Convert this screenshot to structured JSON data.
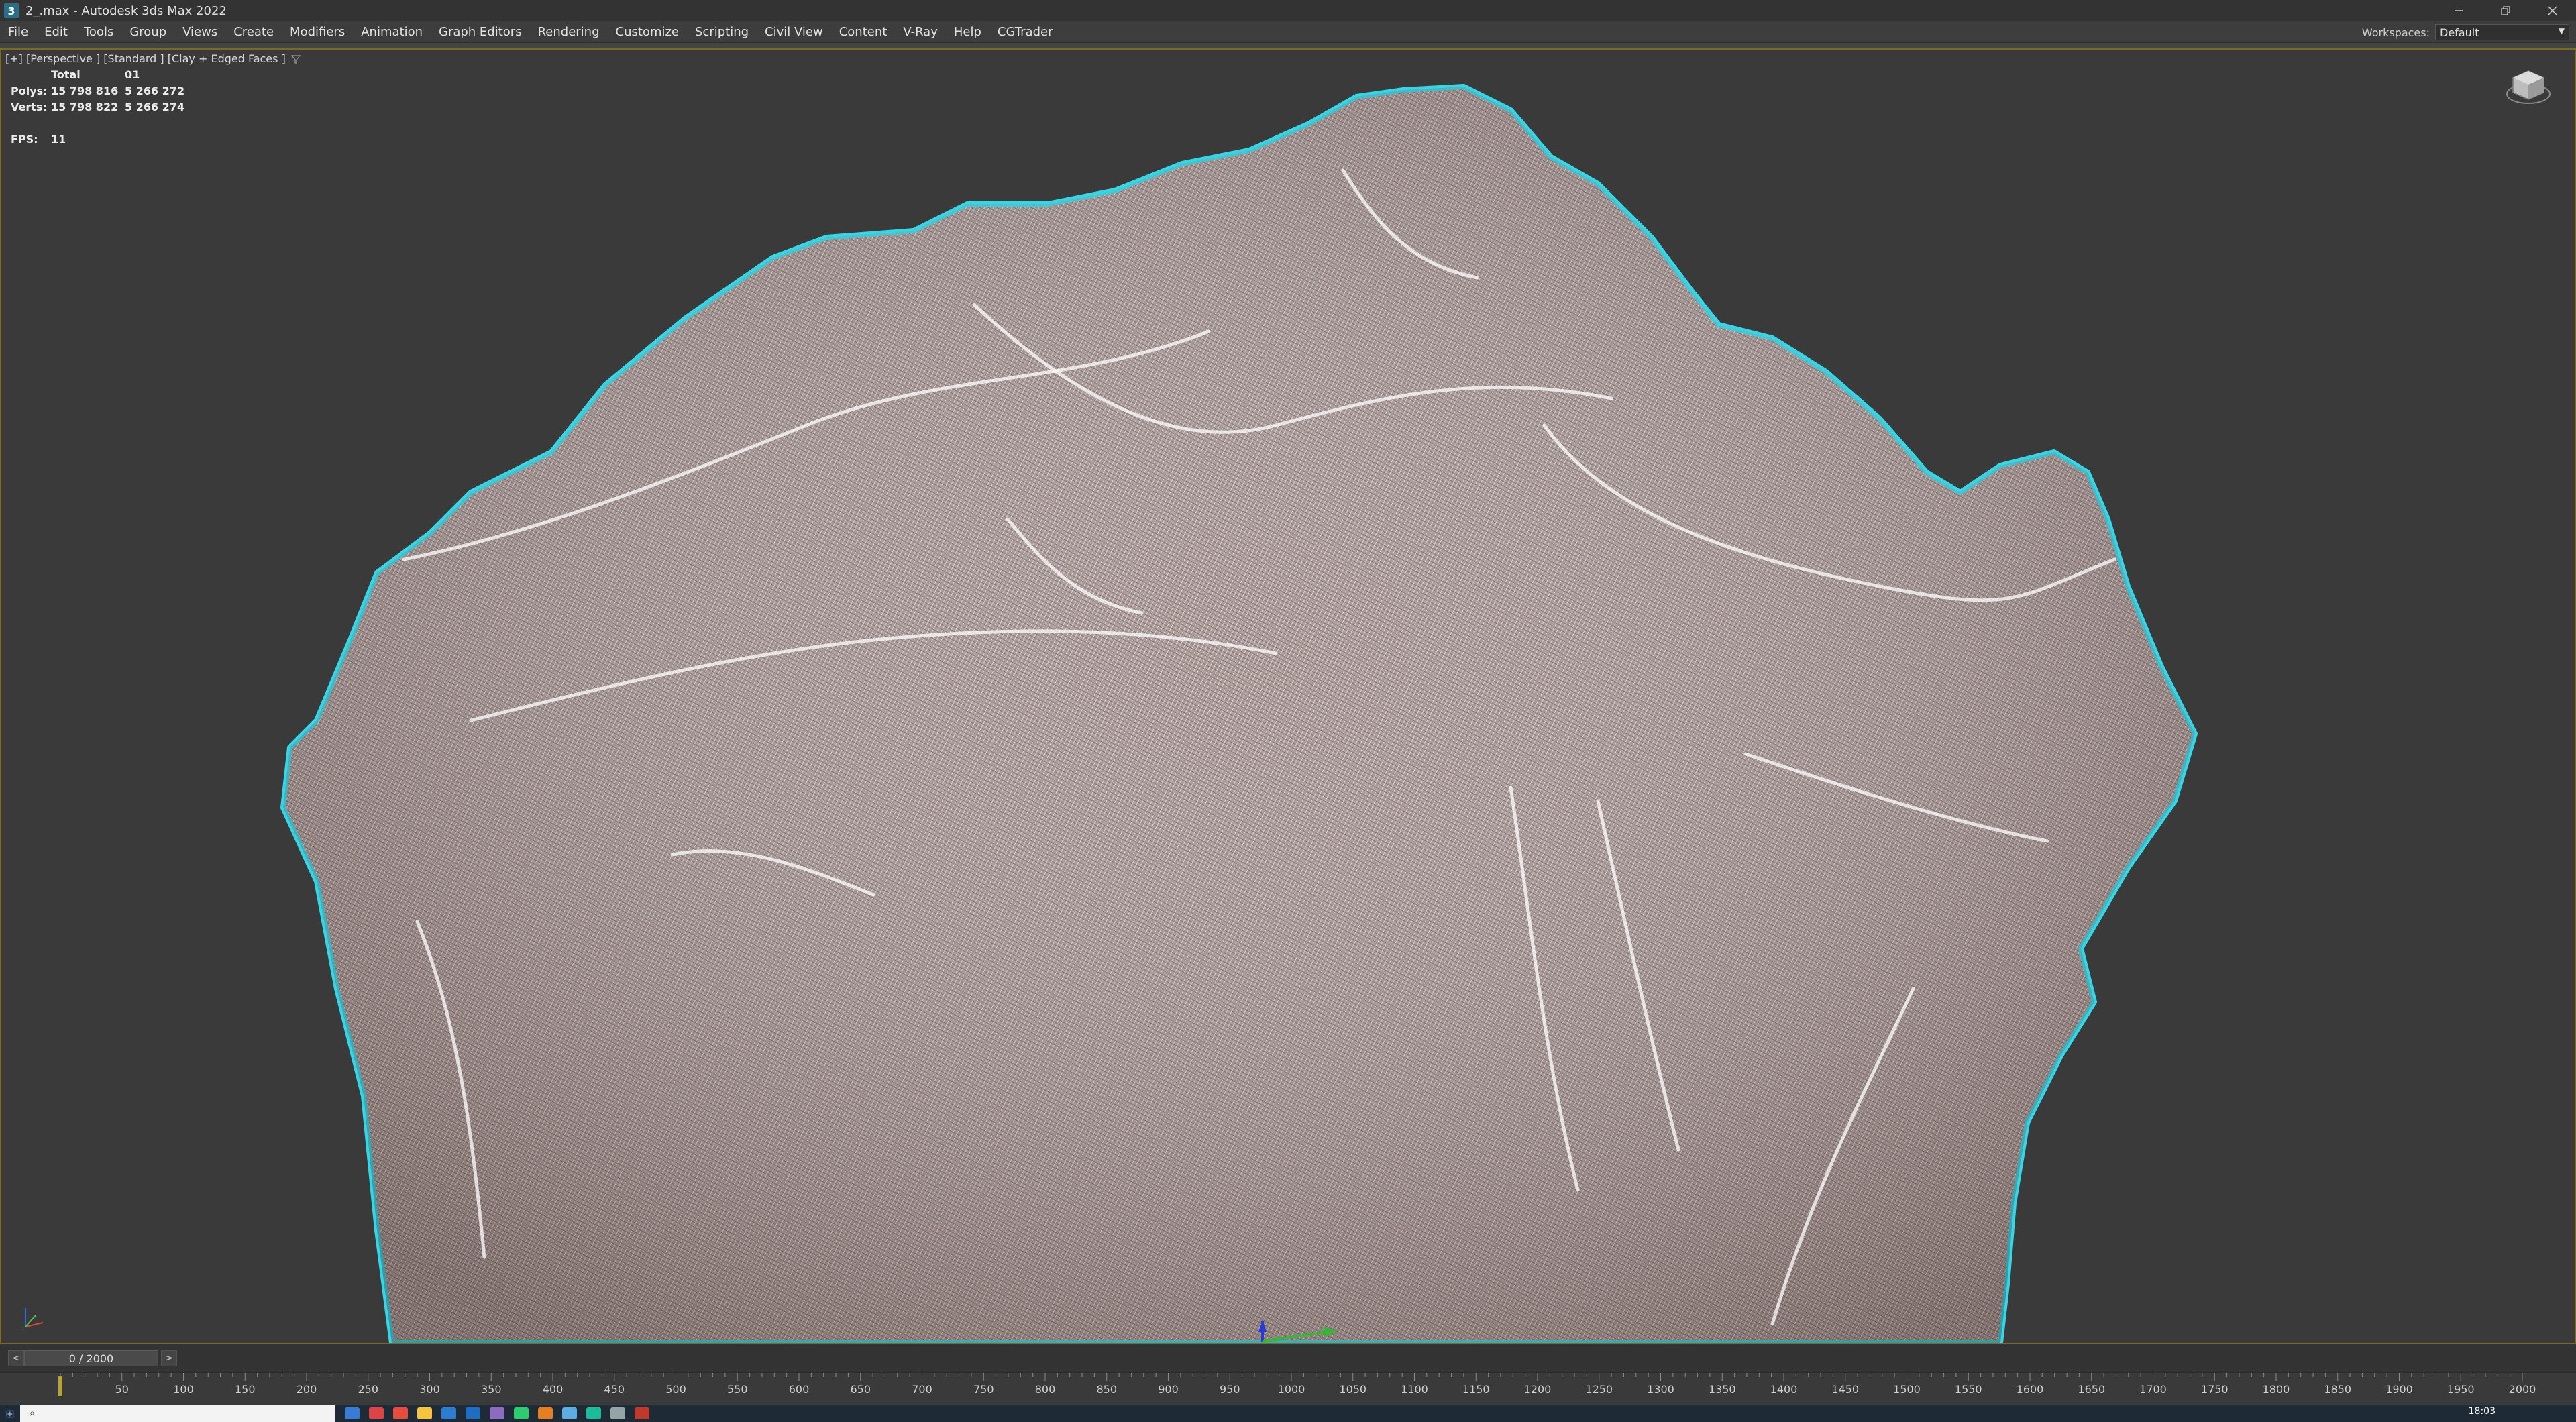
{
  "window": {
    "title": "2_.max - Autodesk 3ds Max 2022",
    "app_icon": "3",
    "controls": [
      "minimize",
      "restore",
      "close"
    ]
  },
  "menu": {
    "items": [
      "File",
      "Edit",
      "Tools",
      "Group",
      "Views",
      "Create",
      "Modifiers",
      "Animation",
      "Graph Editors",
      "Rendering",
      "Customize",
      "Scripting",
      "Civil View",
      "Content",
      "V-Ray",
      "Help",
      "CGTrader"
    ]
  },
  "workspaces": {
    "label": "Workspaces:",
    "value": "Default"
  },
  "viewport": {
    "label": "[+] [Perspective ] [Standard ] [Clay + Edged Faces ]",
    "filter_icon": "filter-icon",
    "stats": {
      "header_total": "Total",
      "header_selected": "01",
      "polys_label": "Polys:",
      "polys_total": "15 798 816",
      "polys_selected": "5 266 272",
      "verts_label": "Verts:",
      "verts_total": "15 798 822",
      "verts_selected": "5 266 274",
      "fps_label": "FPS:",
      "fps_value": "11"
    },
    "colors": {
      "background": "#3a3a3a",
      "mesh": "#b8a8a6",
      "mesh_highlight": "#ffffff",
      "selection_outline": "#36d6e7"
    }
  },
  "timeslider": {
    "prev": "<",
    "next": ">",
    "value": "0 / 2000"
  },
  "trackbar": {
    "ticks": [
      "50",
      "100",
      "150",
      "200",
      "250",
      "300",
      "350",
      "400",
      "450",
      "500",
      "550",
      "600",
      "650",
      "700",
      "750",
      "800",
      "850",
      "900",
      "950",
      "1000",
      "1050",
      "1100",
      "1150",
      "1200",
      "1250",
      "1300",
      "1350",
      "1400",
      "1450",
      "1500",
      "1550",
      "1600",
      "1650",
      "1700",
      "1750",
      "1800",
      "1850",
      "1900",
      "1950",
      "2000"
    ]
  },
  "taskbar": {
    "clock": "18:03"
  }
}
